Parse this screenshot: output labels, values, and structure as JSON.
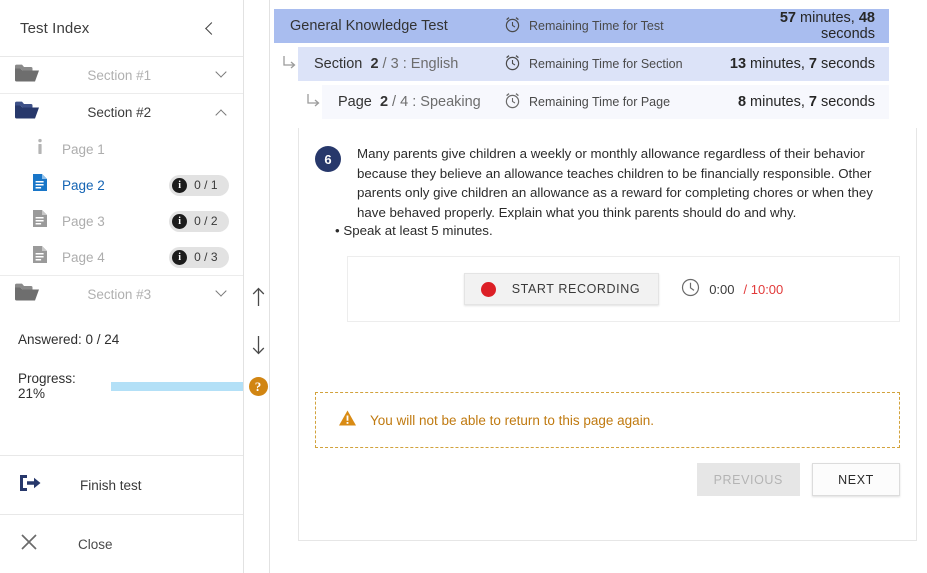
{
  "sidebar": {
    "title": "Test Index",
    "collapse_icon": "chevron-left-icon",
    "sections": [
      {
        "label": "Section #1",
        "icon": "folder-icon",
        "expanded": false,
        "chevron": "chevron-down-icon"
      },
      {
        "label": "Section #2",
        "icon": "folder-open-icon",
        "expanded": true,
        "chevron": "chevron-up-icon"
      },
      {
        "label": "Section #3",
        "icon": "folder-icon",
        "expanded": false,
        "chevron": "chevron-down-icon"
      }
    ],
    "pages": [
      {
        "label": "Page 1",
        "icon": "info-icon",
        "active": false,
        "badge": null
      },
      {
        "label": "Page 2",
        "icon": "document-icon",
        "active": true,
        "badge": "0 / 1"
      },
      {
        "label": "Page 3",
        "icon": "document-icon",
        "active": false,
        "badge": "0 / 2"
      },
      {
        "label": "Page 4",
        "icon": "document-icon",
        "active": false,
        "badge": "0 / 3"
      }
    ],
    "answered_label": "Answered: 0 / 24",
    "progress_label": "Progress: 21%",
    "progress_percent": 21,
    "actions": [
      {
        "label": "Finish test",
        "icon": "exit-icon"
      },
      {
        "label": "Close",
        "icon": "close-icon"
      }
    ]
  },
  "gutter": {
    "scroll_up_icon": "arrow-up-icon",
    "scroll_down_icon": "arrow-down-icon",
    "help_label": "?"
  },
  "header": {
    "test": {
      "name": "General Knowledge Test",
      "timer_icon": "alarm-clock-icon",
      "timer_label": "Remaining Time for Test",
      "time_value_min": "57",
      "time_unit_min": " minutes, ",
      "time_value_sec": "48",
      "time_unit_sec": " seconds"
    },
    "section": {
      "prefix": "Section",
      "current": "2",
      "separator": " / ",
      "total": "3",
      "colon": " : ",
      "name": "English",
      "timer_icon": "alarm-clock-icon",
      "timer_label": "Remaining Time for Section",
      "time_value_min": "13",
      "time_unit_min": " minutes, ",
      "time_value_sec": "7",
      "time_unit_sec": " seconds",
      "branch_icon": "branch-arrow-icon"
    },
    "page": {
      "prefix": "Page",
      "current": "2",
      "separator": " / ",
      "total": "4",
      "colon": " : ",
      "name": "Speaking",
      "timer_icon": "alarm-clock-icon",
      "timer_label": "Remaining Time for Page",
      "time_value_min": "8",
      "time_unit_min": " minutes, ",
      "time_value_sec": "7",
      "time_unit_sec": " seconds",
      "branch_icon": "branch-arrow-icon"
    }
  },
  "question": {
    "number": "6",
    "text": "Many parents give children a weekly or monthly allowance regardless of their behavior because they believe an allowance teaches children to be financially responsible. Other parents only give children an allowance as a reward for completing chores or when they have behaved properly. Explain what you think parents should do and why.",
    "bullet": "• Speak at least 5 minutes."
  },
  "recorder": {
    "button_label": "START RECORDING",
    "record_dot_icon": "record-dot-icon",
    "clock_icon": "clock-icon",
    "current_time": "0:00",
    "separator": " / ",
    "max_time": "10:00"
  },
  "notice": {
    "icon": "warning-triangle-icon",
    "text": "You will not be able to return to this page again."
  },
  "footer": {
    "previous_label": "PREVIOUS",
    "next_label": "NEXT"
  },
  "colors": {
    "bar_test": "#a9bdef",
    "bar_section": "#dce3f8",
    "bar_page": "#f7f8fd",
    "accent_navy": "#27386b",
    "active_blue": "#1464b4",
    "progress_fill": "#039be5",
    "progress_track": "#b3e0f7",
    "record_red": "#dc1f26",
    "warning_amber": "#c07a10",
    "help_amber": "#d18512"
  }
}
